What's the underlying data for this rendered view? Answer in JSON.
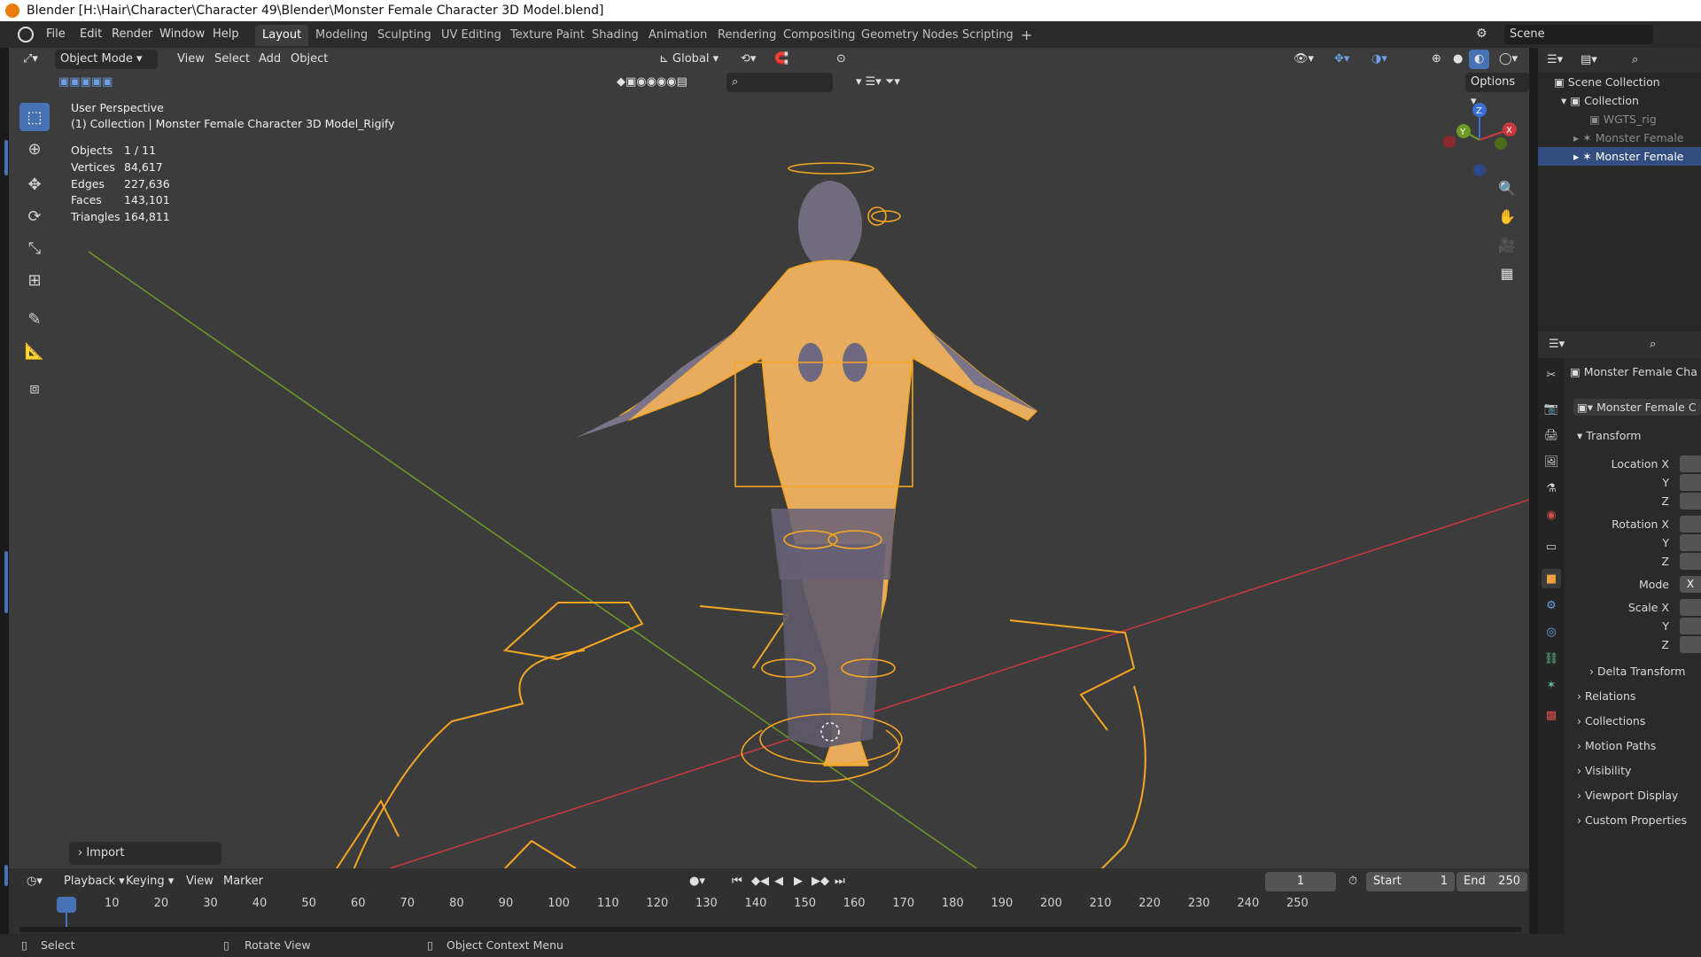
{
  "window": {
    "title": "Blender [H:\\Hair\\Character\\Character 49\\Blender\\Monster Female Character 3D Model.blend]"
  },
  "menu": [
    "File",
    "Edit",
    "Render",
    "Window",
    "Help"
  ],
  "workspaces": [
    "Layout",
    "Modeling",
    "Sculpting",
    "UV Editing",
    "Texture Paint",
    "Shading",
    "Animation",
    "Rendering",
    "Compositing",
    "Geometry Nodes",
    "Scripting"
  ],
  "add_workspace": "+",
  "scene": {
    "label": "Scene"
  },
  "viewport_header": {
    "mode": "Object Mode",
    "menus": [
      "View",
      "Select",
      "Add",
      "Object"
    ],
    "orientation": "Global",
    "options": "Options"
  },
  "overlay": {
    "perspective": "User Perspective",
    "collection": "(1) Collection | Monster Female Character 3D Model_Rigify",
    "stats": [
      {
        "label": "Objects",
        "value": "1 / 11"
      },
      {
        "label": "Vertices",
        "value": "84,617"
      },
      {
        "label": "Edges",
        "value": "227,636"
      },
      {
        "label": "Faces",
        "value": "143,101"
      },
      {
        "label": "Triangles",
        "value": "164,811"
      }
    ]
  },
  "operator_panel": "Import",
  "outliner": {
    "root": "Scene Collection",
    "collection": "Collection",
    "items": [
      "WGTS_rig",
      "Monster Female",
      "Monster Female"
    ]
  },
  "properties": {
    "object_name": "Monster Female Cha",
    "data_name": "Monster Female C",
    "transform": "Transform",
    "location_x": "Location X",
    "y": "Y",
    "z": "Z",
    "rotation_x": "Rotation X",
    "mode": "Mode",
    "mode_value": "X",
    "scale_x": "Scale X",
    "sections": [
      "Delta Transform",
      "Relations",
      "Collections",
      "Motion Paths",
      "Visibility",
      "Viewport Display",
      "Custom Properties"
    ]
  },
  "timeline": {
    "menus": [
      "Playback",
      "Keying",
      "View",
      "Marker"
    ],
    "current_frame": "1",
    "start_label": "Start",
    "start": "1",
    "end_label": "End",
    "end": "250",
    "ticks": [
      "1",
      "10",
      "20",
      "30",
      "40",
      "50",
      "60",
      "70",
      "80",
      "90",
      "100",
      "110",
      "120",
      "130",
      "140",
      "150",
      "160",
      "170",
      "180",
      "190",
      "200",
      "210",
      "220",
      "230",
      "240",
      "250"
    ]
  },
  "statusbar": {
    "select": "Select",
    "rotate": "Rotate View",
    "context": "Object Context Menu"
  },
  "gizmo": {
    "x": "X",
    "y": "Y",
    "z": "Z"
  },
  "colors": {
    "accent": "#4772b3",
    "selection": "#f5a623",
    "viewport_bg": "#3c3c3c",
    "x_axis": "#c8383f",
    "y_axis": "#6d9a24"
  }
}
